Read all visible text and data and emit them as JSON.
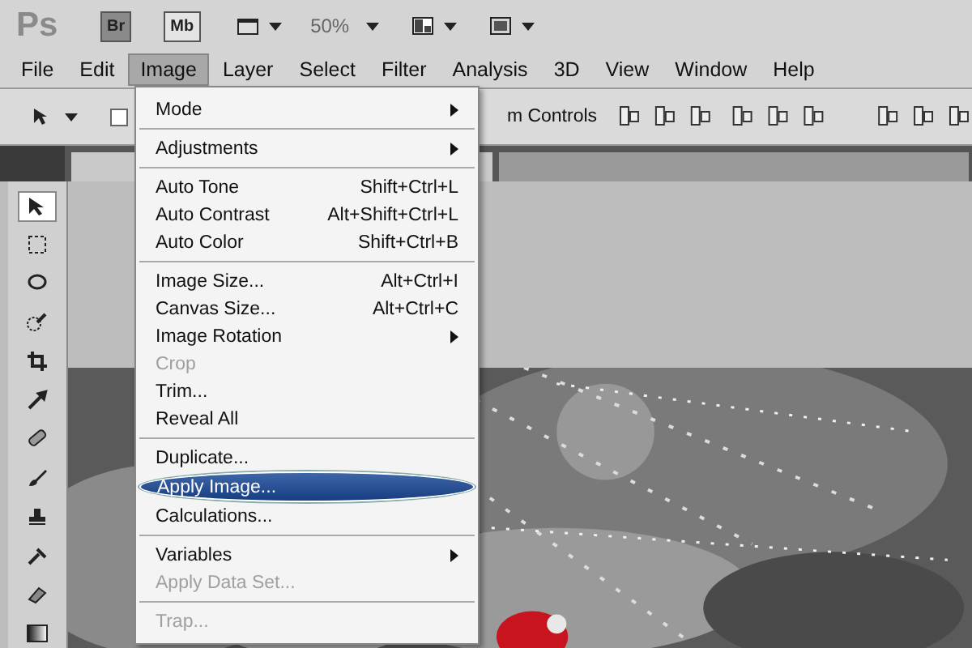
{
  "app_bar": {
    "logo": "Ps",
    "bridge": "Br",
    "mini_bridge": "Mb",
    "zoom": "50%"
  },
  "menu_bar": [
    {
      "label": "File",
      "selected": false
    },
    {
      "label": "Edit",
      "selected": false
    },
    {
      "label": "Image",
      "selected": true
    },
    {
      "label": "Layer",
      "selected": false
    },
    {
      "label": "Select",
      "selected": false
    },
    {
      "label": "Filter",
      "selected": false
    },
    {
      "label": "Analysis",
      "selected": false
    },
    {
      "label": "3D",
      "selected": false
    },
    {
      "label": "View",
      "selected": false
    },
    {
      "label": "Window",
      "selected": false
    },
    {
      "label": "Help",
      "selected": false
    }
  ],
  "options_bar": {
    "checkbox_checked": false,
    "label": "m Controls"
  },
  "image_menu": [
    [
      {
        "label": "Mode",
        "submenu": true,
        "disabled": false,
        "selected": false
      }
    ],
    [
      {
        "label": "Adjustments",
        "submenu": true,
        "disabled": false,
        "selected": false
      }
    ],
    [
      {
        "label": "Auto Tone",
        "shortcut": "Shift+Ctrl+L",
        "submenu": false,
        "disabled": false,
        "selected": false
      },
      {
        "label": "Auto Contrast",
        "shortcut": "Alt+Shift+Ctrl+L",
        "submenu": false,
        "disabled": false,
        "selected": false
      },
      {
        "label": "Auto Color",
        "shortcut": "Shift+Ctrl+B",
        "submenu": false,
        "disabled": false,
        "selected": false
      }
    ],
    [
      {
        "label": "Image Size...",
        "shortcut": "Alt+Ctrl+I",
        "submenu": false,
        "disabled": false,
        "selected": false
      },
      {
        "label": "Canvas Size...",
        "shortcut": "Alt+Ctrl+C",
        "submenu": false,
        "disabled": false,
        "selected": false
      },
      {
        "label": "Image Rotation",
        "submenu": true,
        "disabled": false,
        "selected": false
      },
      {
        "label": "Crop",
        "submenu": false,
        "disabled": true,
        "selected": false
      },
      {
        "label": "Trim...",
        "submenu": false,
        "disabled": false,
        "selected": false
      },
      {
        "label": "Reveal All",
        "submenu": false,
        "disabled": false,
        "selected": false
      }
    ],
    [
      {
        "label": "Duplicate...",
        "submenu": false,
        "disabled": false,
        "selected": false
      },
      {
        "label": "Apply Image...",
        "submenu": false,
        "disabled": false,
        "selected": true
      },
      {
        "label": "Calculations...",
        "submenu": false,
        "disabled": false,
        "selected": false
      }
    ],
    [
      {
        "label": "Variables",
        "submenu": true,
        "disabled": false,
        "selected": false
      },
      {
        "label": "Apply Data Set...",
        "submenu": false,
        "disabled": true,
        "selected": false
      }
    ],
    [
      {
        "label": "Trap...",
        "submenu": false,
        "disabled": true,
        "selected": false
      }
    ]
  ]
}
